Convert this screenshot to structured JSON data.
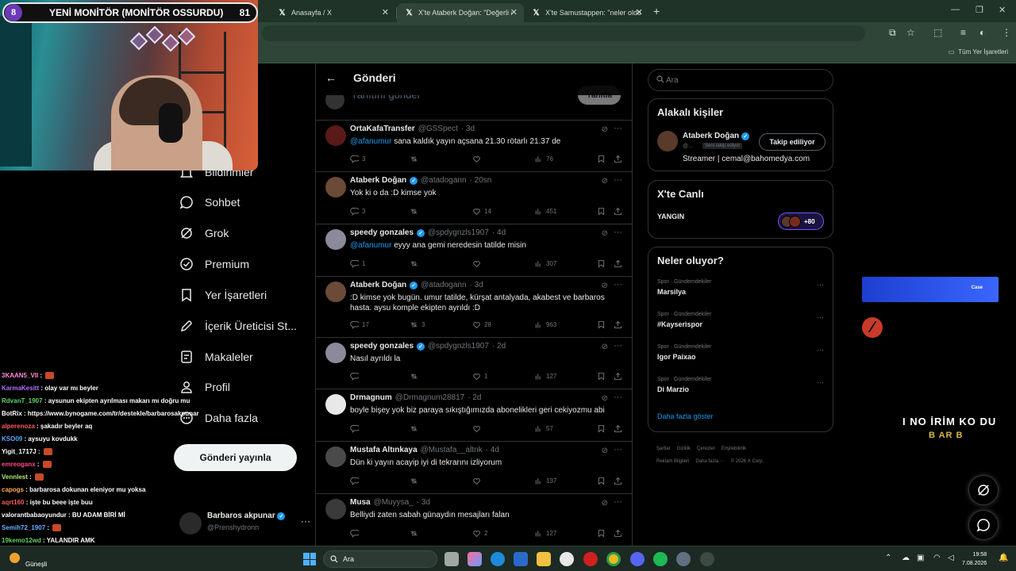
{
  "browser": {
    "tabs": [
      {
        "label": "Anasayfa / X",
        "icon": "x-logo-icon"
      },
      {
        "label": "X'te Ataberk Doğan: \"Değerli a",
        "icon": "x-logo-icon"
      },
      {
        "label": "X'te Samustappen: \"neler oldu",
        "icon": "x-logo-icon"
      }
    ],
    "partial_tab_label": "An",
    "bookmarks_folder": "Tüm Yer İşaretleri"
  },
  "stream": {
    "badge_number": "8",
    "title": "YENİ MONİTÖR (MONİTÖR OSSURDU)",
    "viewer_count": "81",
    "overlay_title": "I NO İRİM KO DU",
    "overlay_sub": "B AR B",
    "banner_label": "Case"
  },
  "nav": {
    "items": [
      {
        "label": "Bildirimler",
        "icon": "bell-icon"
      },
      {
        "label": "Sohbet",
        "icon": "chat-bubble-icon"
      },
      {
        "label": "Grok",
        "icon": "grok-icon"
      },
      {
        "label": "Premium",
        "icon": "premium-badge-icon"
      },
      {
        "label": "Yer İşaretleri",
        "icon": "bookmark-icon"
      },
      {
        "label": "İçerik Üreticisi St...",
        "icon": "rocket-icon"
      },
      {
        "label": "Makaleler",
        "icon": "articles-icon"
      },
      {
        "label": "Profil",
        "icon": "person-icon"
      },
      {
        "label": "Daha fazla",
        "icon": "more-circle-icon"
      }
    ],
    "post_button": "Gönderi yayınla",
    "profile": {
      "name": "Barbaros akpunar",
      "handle": "@Prenshydronn"
    }
  },
  "chat": {
    "lines": [
      {
        "user": "3KAAN5_VII",
        "color": "#ff8bd6",
        "text": ""
      },
      {
        "user": "KarmaKesitt",
        "color": "#b070ff",
        "text": "olay var mı beyler"
      },
      {
        "user": "RdvanT_1907",
        "color": "#5fd46a",
        "text": "aysunun ekipten ayrılması makarı mı doğru mu"
      },
      {
        "user": "BotRix",
        "color": "#ffffff",
        "text": "https://www.bynogame.com/tr/destekle/barbarosakpunar"
      },
      {
        "user": "alperenoza",
        "color": "#ff5a5a",
        "text": "şakadır beyler aq"
      },
      {
        "user": "KSO09",
        "color": "#5aa8ff",
        "text": "aysuyu kovdukk"
      },
      {
        "user": "Yigit_1717J",
        "color": "#ffffff",
        "text": ""
      },
      {
        "user": "emreoganx",
        "color": "#ff4a8a",
        "text": ""
      },
      {
        "user": "Vennlest",
        "color": "#aee86a",
        "text": ""
      },
      {
        "user": "capogs",
        "color": "#ffb060",
        "text": "barbarosa dokunan eleniyor mu yoksa"
      },
      {
        "user": "aqrt160",
        "color": "#ff5a5a",
        "text": "işte bu beee işte buu"
      },
      {
        "user": "valorantbabaoyundur",
        "color": "#ffffff",
        "text": "BU ADAM BİRİ Mİ"
      },
      {
        "user": "Semih72_1907",
        "color": "#6ab0ff",
        "text": ""
      },
      {
        "user": "19kemo12wd",
        "color": "#5fd46a",
        "text": "YALANDIR AMK"
      }
    ]
  },
  "center": {
    "title": "Gönderi",
    "reply_placeholder": "Yanıtını gönder",
    "reply_button": "Yanıtla",
    "tweets": [
      {
        "name": "OrtaKafaTransfer",
        "verified": false,
        "handle": "@GSSpect",
        "time": "· 3d",
        "mention": "@afanumur",
        "text": "sana kaldık yayın açsana 21.30 rötarlı 21.37 de",
        "replies": "3",
        "retweets": "",
        "likes": "",
        "views": "76",
        "avatar": "#5a1a18"
      },
      {
        "name": "Ataberk Doğan",
        "verified": true,
        "handle": "@atadogann",
        "time": "· 20sn",
        "mention": "",
        "text": "Yok ki o da :D kimse yok",
        "replies": "3",
        "retweets": "",
        "likes": "14",
        "views": "451",
        "avatar": "#6b4a38"
      },
      {
        "name": "speedy gonzales",
        "verified": true,
        "handle": "@spdygnzls1907",
        "time": "· 4d",
        "mention": "@afanumur",
        "text": "eyyy ana gemi neredesin tatilde misin",
        "replies": "1",
        "retweets": "",
        "likes": "",
        "views": "307",
        "avatar": "#8a8a9a"
      },
      {
        "name": "Ataberk Doğan",
        "verified": true,
        "handle": "@atadogann",
        "time": "· 3d",
        "mention": "",
        "text": ":D kimse yok bugün. umur tatilde, kürşat antalyada, akabest ve barbaros hasta. aysu komple ekipten ayrıldı :D",
        "replies": "17",
        "retweets": "3",
        "likes": "28",
        "views": "963",
        "avatar": "#6b4a38"
      },
      {
        "name": "speedy gonzales",
        "verified": true,
        "handle": "@spdygnzls1907",
        "time": "· 2d",
        "mention": "",
        "text": "Nasıl ayrıldı la",
        "replies": "",
        "retweets": "",
        "likes": "1",
        "views": "127",
        "avatar": "#8a8a9a"
      },
      {
        "name": "Drmagnum",
        "verified": false,
        "handle": "@Drmagnum28817",
        "time": "· 2d",
        "mention": "",
        "text": "boyle bişey yok biz paraya sıkıştığımızda abonelikleri geri cekiyozmu abi",
        "replies": "",
        "retweets": "",
        "likes": "",
        "views": "57",
        "avatar": "#e8e8e8"
      },
      {
        "name": "Mustafa Altınkaya",
        "verified": false,
        "handle": "@Mustafa__altnk",
        "time": "· 4d",
        "mention": "",
        "text": "Dün ki yayın acayip iyi di tekrarını izliyorum",
        "replies": "",
        "retweets": "",
        "likes": "",
        "views": "137",
        "avatar": "#4a4a4a"
      },
      {
        "name": "Musa",
        "verified": false,
        "handle": "@Muyysa_",
        "time": "· 3d",
        "mention": "",
        "text": "Belliydi zaten sabah günaydın mesajları falan",
        "replies": "",
        "retweets": "",
        "likes": "2",
        "views": "127",
        "avatar": "#3a3a3a"
      }
    ]
  },
  "right": {
    "search_placeholder": "Ara",
    "related": {
      "title": "Alakalı kişiler",
      "name": "Ataberk Doğan",
      "handle": "@...",
      "follows_you": "Seni takip ediyor",
      "follow_button": "Takip ediliyor",
      "bio": "Streamer | cemal@bahomedya.com"
    },
    "live": {
      "title": "X'te Canlı",
      "label": "YANGIN",
      "count": "+80"
    },
    "trends": {
      "title": "Neler oluyor?",
      "items": [
        {
          "category": "Spor · Gündemdekiler",
          "name": "Marsilya"
        },
        {
          "category": "Spor · Gündemdekiler",
          "name": "#Kayserispor"
        },
        {
          "category": "Spor · Gündemdekiler",
          "name": "Igor Paixao"
        },
        {
          "category": "Spor · Gündemdekiler",
          "name": "Di Marzio"
        }
      ],
      "show_more": "Daha fazla göster"
    },
    "footer": [
      "Şartlar",
      "Gizlilik",
      "Çerezler",
      "Erişilebilirlik",
      "Reklam Bilgileri",
      "Daha fazla ···",
      "© 2026 X Corp."
    ]
  },
  "taskbar": {
    "weather_temp": "",
    "weather_cond": "Güneşli",
    "search_placeholder": "Ara",
    "time": "19:58",
    "date": "7.08.2026"
  }
}
